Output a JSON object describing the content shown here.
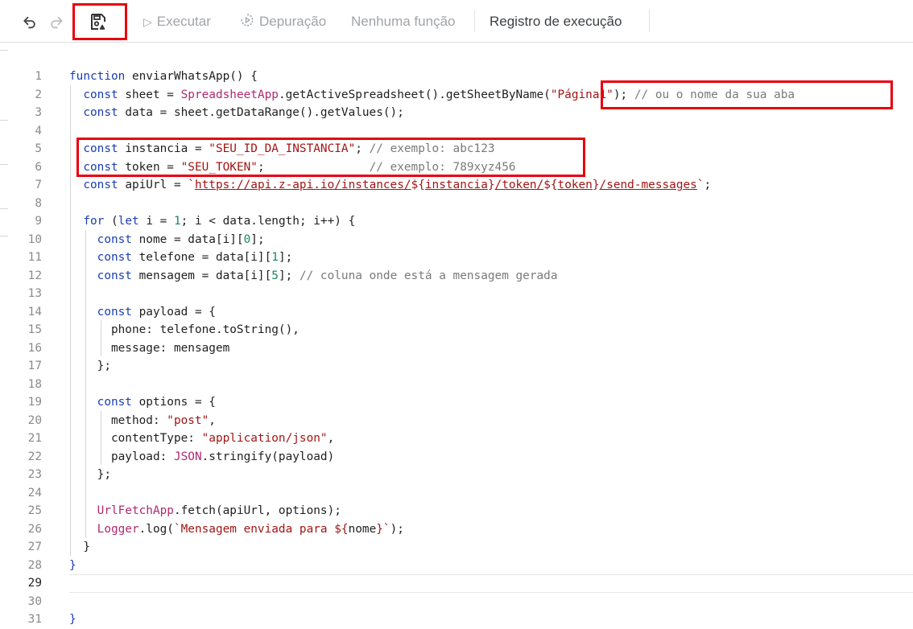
{
  "toolbar": {
    "undo_icon": "undo-icon",
    "redo_icon": "redo-icon",
    "save_icon": "save-drive-icon",
    "run_label": "Executar",
    "debug_label": "Depuração",
    "function_select": "Nenhuma função",
    "log_label": "Registro de execução"
  },
  "editor": {
    "line_numbers": [
      "1",
      "2",
      "3",
      "4",
      "5",
      "6",
      "7",
      "8",
      "9",
      "10",
      "11",
      "12",
      "13",
      "14",
      "15",
      "16",
      "17",
      "18",
      "19",
      "20",
      "21",
      "22",
      "23",
      "24",
      "25",
      "26",
      "27",
      "28",
      "29",
      "30",
      "31"
    ],
    "lines": [
      "function enviarWhatsApp() {",
      "  const sheet = SpreadsheetApp.getActiveSpreadsheet().getSheetByName(\"Página1\"); // ou o nome da sua aba",
      "  const data = sheet.getDataRange().getValues();",
      "",
      "  const instancia = \"SEU_ID_DA_INSTANCIA\"; // exemplo: abc123",
      "  const token = \"SEU_TOKEN\";               // exemplo: 789xyz456",
      "  const apiUrl = `https://api.z-api.io/instances/${instancia}/token/${token}/send-messages`;",
      "",
      "  for (let i = 1; i < data.length; i++) {",
      "    const nome = data[i][0];",
      "    const telefone = data[i][1];",
      "    const mensagem = data[i][5]; // coluna onde está a mensagem gerada",
      "",
      "    const payload = {",
      "      phone: telefone.toString(),",
      "      message: mensagem",
      "    };",
      "",
      "    const options = {",
      "      method: \"post\",",
      "      contentType: \"application/json\",",
      "      payload: JSON.stringify(payload)",
      "    };",
      "",
      "    UrlFetchApp.fetch(apiUrl, options);",
      "    Logger.log(`Mensagem enviada para ${nome}`);",
      "  }",
      "}",
      "",
      "",
      "}"
    ]
  },
  "colors": {
    "keyword": "#1a3db3",
    "string": "#a31515",
    "comment": "#7a7a7a",
    "number": "#128a55",
    "class": "#b02a6e",
    "highlight_box": "#e8000b"
  }
}
